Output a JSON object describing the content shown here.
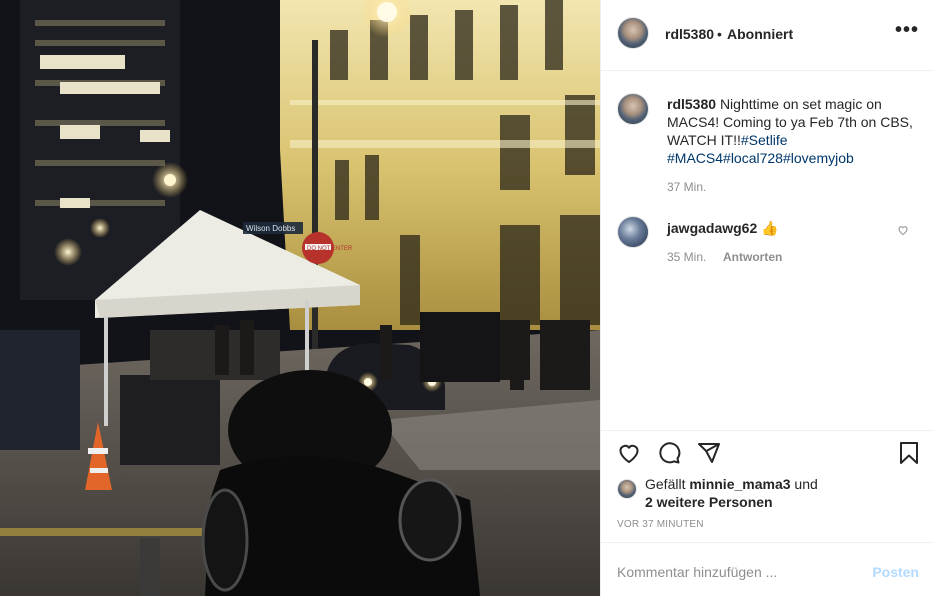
{
  "post": {
    "image_alt": "Night street scene film set",
    "header": {
      "username": "rdl5380",
      "separator": "•",
      "follow_status": "Abonniert",
      "more": "•••"
    },
    "caption": {
      "username": "rdl5380",
      "text": "Nighttime on set magic on MACS4! Coming to ya Feb 7th on CBS, WATCH IT!!",
      "hashtags": [
        "#Setlife",
        "#MACS4",
        "#local728",
        "#lovemyjob"
      ],
      "time": "37 Min."
    },
    "comments": [
      {
        "username": "jawgadawg62",
        "text": "👍",
        "time": "35 Min.",
        "reply_label": "Antworten"
      }
    ],
    "likes": {
      "prefix": "Gefällt",
      "user": "minnie_mama3",
      "and": "und",
      "others": "2 weitere Personen"
    },
    "timestamp": "VOR 37 MINUTEN",
    "add_comment": {
      "placeholder": "Kommentar hinzufügen ...",
      "post_label": "Posten"
    },
    "photo_signs": {
      "street": "Wilson Dobbs",
      "stop": "DO NOT ENTER"
    }
  },
  "colors": {
    "text": "#262626",
    "secondary": "#8e8e8e",
    "link": "#00376b",
    "post_disabled": "#b3dbff",
    "border": "#efefef"
  },
  "icons": [
    "heart-icon",
    "comment-icon",
    "share-icon",
    "bookmark-icon",
    "more-icon",
    "thumbs-up-emoji"
  ]
}
